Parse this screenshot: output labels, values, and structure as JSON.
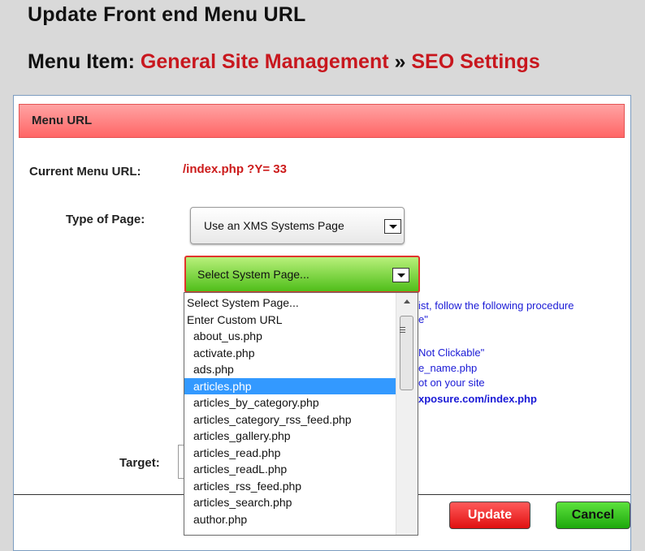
{
  "page": {
    "title": "Update Front end Menu URL",
    "menu_item_label": "Menu Item:",
    "breadcrumb_parent": "General Site Management",
    "breadcrumb_separator": "»",
    "breadcrumb_current": "SEO Settings"
  },
  "panel": {
    "header": "Menu URL",
    "current_url_label": "Current Menu URL:",
    "current_url_value": "/index.php ?Y= 33",
    "type_label": "Type of Page:",
    "type_value": "Use an XMS Systems Page",
    "system_select_value": "Select System Page...",
    "target_label": "Target:",
    "info_lines": [
      "ist, follow the following procedure",
      "e\"",
      "Not Clickable\"",
      "e_name.php",
      "ot on your site",
      "xposure.com/index.php"
    ],
    "update_button": "Update",
    "cancel_button": "Cancel"
  },
  "dropdown": {
    "options": [
      "Select System Page...",
      "Enter Custom URL",
      "about_us.php",
      "activate.php",
      "ads.php",
      "articles.php",
      "articles_by_category.php",
      "articles_category_rss_feed.php",
      "articles_gallery.php",
      "articles_read.php",
      "articles_readL.php",
      "articles_rss_feed.php",
      "articles_search.php",
      "author.php"
    ],
    "selected": "articles.php"
  },
  "colors": {
    "header_bar": "#ff6666",
    "accent_red": "#c8171e",
    "info_blue": "#1a1ad6",
    "select_green": "#4fbe1a",
    "highlight": "#3399ff"
  }
}
